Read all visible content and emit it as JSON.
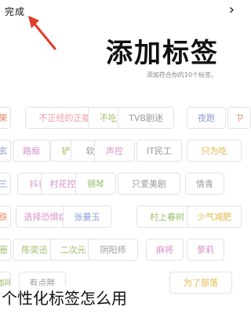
{
  "header": {
    "done_label": "完成",
    "back_icon": "chevron-right-icon",
    "title": "添加标签",
    "subtitle": "添加符合你的10个标签。"
  },
  "annotation_arrow": {
    "color": "#e23b2a"
  },
  "tags": [
    {
      "label": "果",
      "color": "#e98a6a"
    },
    {
      "label": "不正经的正能量",
      "color": "#f09aa6"
    },
    {
      "label": "不吃肉不能活",
      "color": "#9dbc6a"
    },
    {
      "label": "TVB剧迷",
      "color": "#9a9a9a"
    },
    {
      "label": "夜跑",
      "color": "#8b9dd6"
    },
    {
      "label": "ㄗ",
      "color": "#e98a6a"
    },
    {
      "label": "玄",
      "color": "#8b9dd6"
    },
    {
      "label": "路痴",
      "color": "#d693c8"
    },
    {
      "label": "铲屎官",
      "color": "#9dbc6a"
    },
    {
      "label": "软妹子",
      "color": "#9a9a9a"
    },
    {
      "label": "声控",
      "color": "#d693c8"
    },
    {
      "label": "IT民工",
      "color": "#9a9a9a"
    },
    {
      "label": "只为吃",
      "color": "#e5b84a"
    },
    {
      "label": "三",
      "color": "#8b9dd6"
    },
    {
      "label": "抖音控",
      "color": "#d693c8"
    },
    {
      "label": "村花控",
      "color": "#d693c8"
    },
    {
      "label": "钢琴",
      "color": "#9dbc6a"
    },
    {
      "label": "只爱美剧",
      "color": "#9a9a9a"
    },
    {
      "label": "情青",
      "color": "#9a9a9a"
    },
    {
      "label": "铁",
      "color": "#e98a6a"
    },
    {
      "label": "选择恐惧症",
      "color": "#d693c8"
    },
    {
      "label": "张曼玉",
      "color": "#8b9dd6"
    },
    {
      "label": "村上春树",
      "color": "#9dbc6a"
    },
    {
      "label": "少气减肥",
      "color": "#e5b84a"
    },
    {
      "label": "圈",
      "color": "#9dbc6a"
    },
    {
      "label": "陈奕迅",
      "color": "#9dbc6a"
    },
    {
      "label": "二次元",
      "color": "#9dbc6a"
    },
    {
      "label": "阴阳师",
      "color": "#9a9a9a"
    },
    {
      "label": "麻将",
      "color": "#d693c8"
    },
    {
      "label": "萝莉",
      "color": "#d693c8"
    },
    {
      "label": "咖啡",
      "color": "#9dbc6a"
    },
    {
      "label": "有点胖",
      "color": "#9a9a9a"
    },
    {
      "label": "为了部落",
      "color": "#e5b84a"
    }
  ],
  "caption": "个性化标签怎么用"
}
